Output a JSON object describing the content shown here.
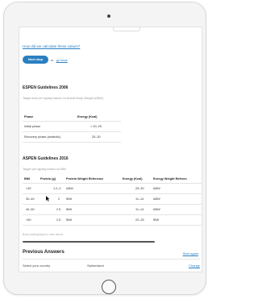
{
  "links": {
    "how_calc": "How did we calculate these values?",
    "go_back": "go back"
  },
  "actions": {
    "next_step": "Next step",
    "or": "or"
  },
  "espen": {
    "title": "ESPEN Guidelines 2006",
    "subtitle": "Target kcal per kg/day based on Actual Body Weight (ABW)",
    "columns": [
      "Phase",
      "Energy (Kcal)"
    ],
    "rows": [
      [
        "Initial phase",
        "< 20–25"
      ],
      [
        "Recovery phase (anabolic)",
        "25–30"
      ]
    ]
  },
  "aspen": {
    "title": "ASPEN Guidelines 2016",
    "subtitle": "Target per kg/day based on BMI",
    "columns": [
      "BMI",
      "Protein (g)",
      "Protein Weight Reference",
      "Energy (Kcal)",
      "Energy Weight Referen"
    ],
    "rows": [
      [
        "<30",
        "1.2–2",
        "ABW",
        "25–30",
        "ABW"
      ],
      [
        "30–40",
        "2",
        "IBW",
        "11–14",
        "ABW"
      ],
      [
        "40–50",
        "2.5",
        "IBW",
        "11–14",
        "ABW"
      ],
      [
        ">50",
        "2.5",
        "IBW",
        "22–25",
        "IBW"
      ]
    ],
    "note": "Body kcal/kg/day for rows above"
  },
  "previous": {
    "title": "Previous Answers",
    "start_again": "Start again",
    "country_label": "Select your country",
    "country_value": "Switzerland",
    "change": "Change"
  }
}
